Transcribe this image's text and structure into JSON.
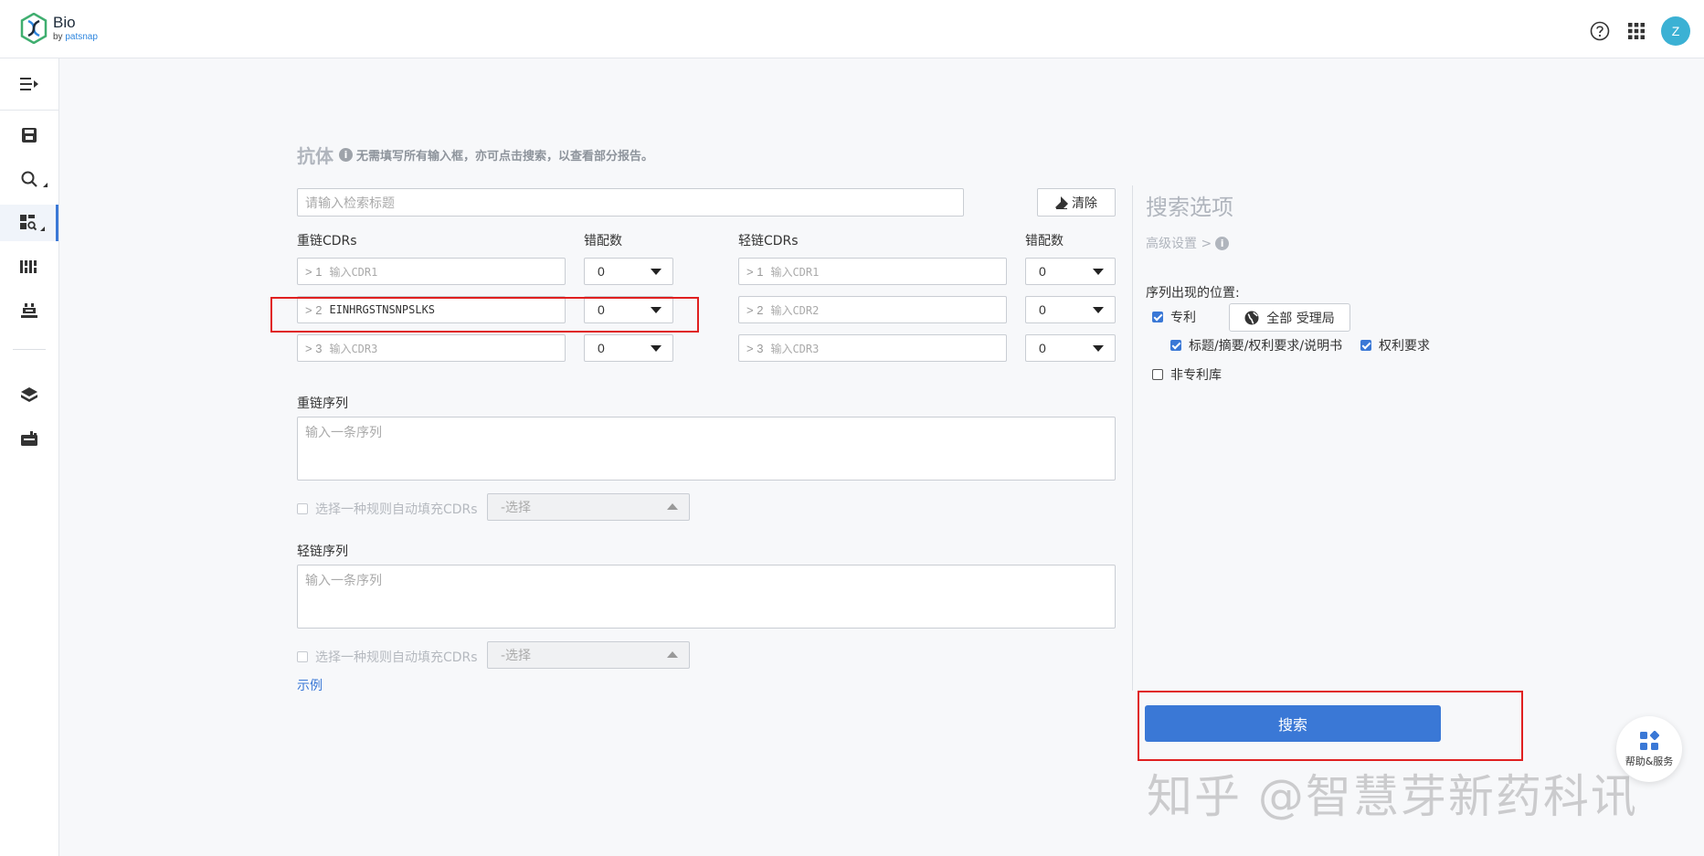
{
  "app": {
    "logo_name": "Bio",
    "logo_by": "by",
    "logo_brand": "patsnap",
    "avatar_letter": "Z"
  },
  "header_icons": [
    "help-circle-icon",
    "apps-grid-icon"
  ],
  "sidebar": {
    "items": [
      "menu-collapse-icon",
      "save-icon",
      "search-icon",
      "dashboard-search-icon",
      "sequence-icon",
      "lab-icon",
      "layers-icon",
      "folder-chart-icon"
    ]
  },
  "form": {
    "title": "抗体",
    "hint": "无需填写所有输入框，亦可点击搜索，以查看部分报告。",
    "search_title_placeholder": "请输入检索标题",
    "clear_label": "清除",
    "heavy_cdrs_label": "重链CDRs",
    "heavy_mismatch_label": "错配数",
    "light_cdrs_label": "轻链CDRs",
    "light_mismatch_label": "错配数",
    "heavy_cdrs": [
      {
        "prefix": "> 1",
        "value": "",
        "placeholder": "输入CDR1",
        "mismatch": "0"
      },
      {
        "prefix": "> 2",
        "value": "EINHRGSTNSNPSLKS",
        "placeholder": "输入CDR2",
        "mismatch": "0"
      },
      {
        "prefix": "> 3",
        "value": "",
        "placeholder": "输入CDR3",
        "mismatch": "0"
      }
    ],
    "light_cdrs": [
      {
        "prefix": "> 1",
        "value": "",
        "placeholder": "输入CDR1",
        "mismatch": "0"
      },
      {
        "prefix": "> 2",
        "value": "",
        "placeholder": "输入CDR2",
        "mismatch": "0"
      },
      {
        "prefix": "> 3",
        "value": "",
        "placeholder": "输入CDR3",
        "mismatch": "0"
      }
    ],
    "heavy_seq_label": "重链序列",
    "heavy_seq_placeholder": "输入一条序列",
    "heavy_autofill_label": "选择一种规则自动填充CDRs",
    "heavy_rule_placeholder": "-选择",
    "light_seq_label": "轻链序列",
    "light_seq_placeholder": "输入一条序列",
    "light_autofill_label": "选择一种规则自动填充CDRs",
    "light_rule_placeholder": "-选择",
    "example_link": "示例"
  },
  "options": {
    "title": "搜索选项",
    "advanced": "高级设置 >",
    "position_label": "序列出现的位置:",
    "patent_label": "专利",
    "patent_checked": true,
    "office_button": "全部 受理局",
    "title_abstract_label": "标题/摘要/权利要求/说明书",
    "title_abstract_checked": true,
    "claims_label": "权利要求",
    "claims_checked": true,
    "non_patent_label": "非专利库",
    "non_patent_checked": false,
    "search_button": "搜索"
  },
  "help": {
    "label": "帮助&服务"
  },
  "watermark": "知乎 @智慧芽新药科讯",
  "colors": {
    "accent": "#3a78d6",
    "highlight_box": "#e02020",
    "avatar": "#3bb1d4"
  }
}
